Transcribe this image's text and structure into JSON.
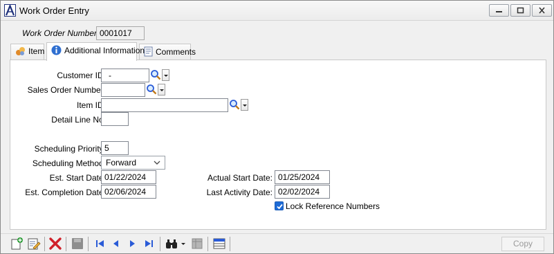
{
  "window": {
    "title": "Work Order Entry",
    "app_logo": "A"
  },
  "header": {
    "wo_number_label": "Work Order Number:",
    "wo_number_value": "0001017"
  },
  "tabs": [
    {
      "label": "Item",
      "icon": "item-icon"
    },
    {
      "label": "Additional Information",
      "icon": "info-icon"
    },
    {
      "label": "Comments",
      "icon": "comments-icon"
    }
  ],
  "form": {
    "customer_id": {
      "label": "Customer ID:",
      "value": "-"
    },
    "sales_order_number": {
      "label": "Sales Order Number:",
      "value": ""
    },
    "item_id": {
      "label": "Item ID:",
      "value": ""
    },
    "detail_line_no": {
      "label": "Detail Line No:",
      "value": ""
    },
    "scheduling_priority": {
      "label": "Scheduling Priority:",
      "value": "5"
    },
    "scheduling_method": {
      "label": "Scheduling Method:",
      "value": "Forward"
    },
    "est_start_date": {
      "label": "Est. Start Date:",
      "value": "01/22/2024"
    },
    "est_completion_date": {
      "label": "Est. Completion Date:",
      "value": "02/06/2024"
    },
    "actual_start_date": {
      "label": "Actual Start Date:",
      "value": "01/25/2024"
    },
    "last_activity_date": {
      "label": "Last Activity Date:",
      "value": "02/02/2024"
    },
    "lock_reference_numbers": {
      "label": "Lock Reference Numbers",
      "checked": true
    }
  },
  "toolbar": {
    "copy_label": "Copy"
  },
  "colors": {
    "accent": "#1e6bd6",
    "nav_blue": "#2a5bd7",
    "delete_red": "#d0202a"
  }
}
